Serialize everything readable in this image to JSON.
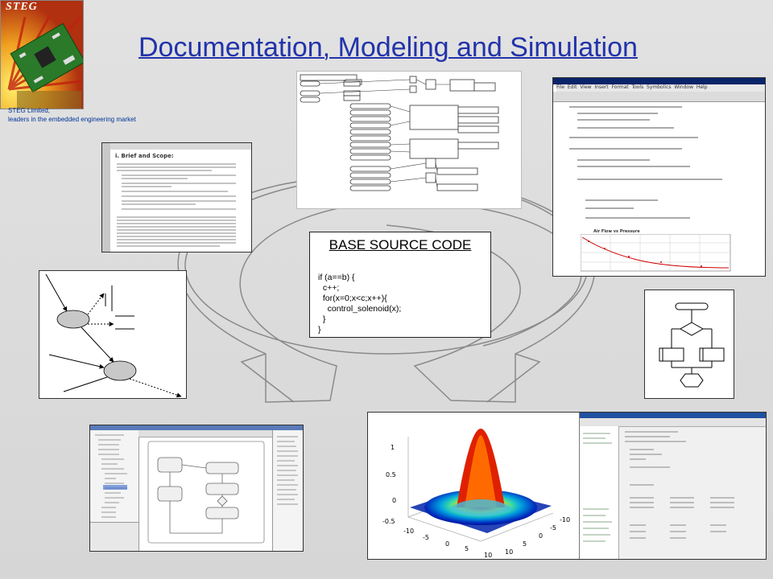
{
  "logo": {
    "title": "STEG",
    "alt_icon": "circuit-board-sun-icon"
  },
  "company": {
    "name": "STEG Limited,",
    "tagline": "leaders in the embedded engineering market"
  },
  "slide": {
    "title": "Documentation, Modeling and Simulation"
  },
  "source_code": {
    "title": "BASE SOURCE CODE",
    "code": "if (a==b) {\n  c++;\n  for(x=0;x<c;x++){\n    control_solenoid(x);\n  }\n}"
  },
  "document": {
    "heading": "i.   Brief and Scope:"
  },
  "simulink": {
    "icon": "simulink-block-diagram-icon"
  },
  "mathcad": {
    "plot_title": "Air Flow vs Pressure",
    "menu": [
      "File",
      "Edit",
      "View",
      "Insert",
      "Format",
      "Tools",
      "Symbolics",
      "Window",
      "Help"
    ]
  },
  "plot3d": {
    "z_ticks": [
      "1",
      "0.5",
      "0",
      "-0.5"
    ],
    "x_ticks": [
      "-10",
      "-5",
      "0",
      "5",
      "10"
    ],
    "y_ticks": [
      "10",
      "5",
      "0",
      "-5",
      "-10"
    ]
  },
  "colors": {
    "title": "#2233aa",
    "company": "#003399",
    "logo_bg": "#d8a830"
  }
}
